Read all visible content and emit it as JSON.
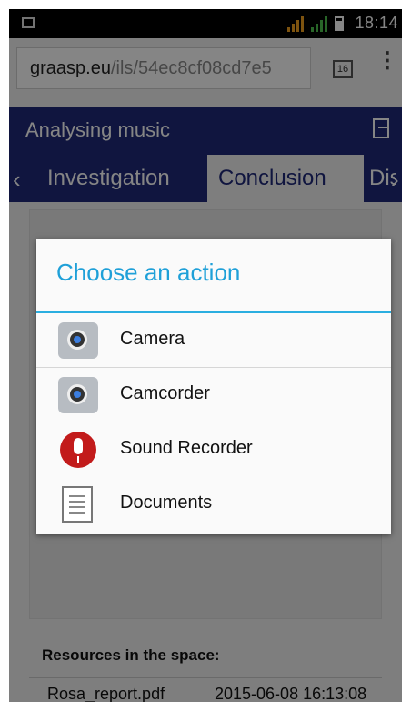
{
  "status_bar": {
    "time": "18:14"
  },
  "browser": {
    "url_domain": "graasp.eu",
    "url_path": "/ils/54ec8cf08cd7e5",
    "tab_count": "16",
    "menu_glyph": "⋮"
  },
  "app": {
    "title": "Analysing music",
    "tabs": [
      {
        "label": "Investigation"
      },
      {
        "label": "Conclusion"
      },
      {
        "label": "Dis"
      }
    ],
    "prev_glyph": "‹",
    "next_glyph": "›"
  },
  "dialog": {
    "title": "Choose an action",
    "items": [
      {
        "label": "Camera",
        "icon": "camera-icon"
      },
      {
        "label": "Camcorder",
        "icon": "camcorder-icon"
      },
      {
        "label": "Sound Recorder",
        "icon": "microphone-icon"
      },
      {
        "label": "Documents",
        "icon": "document-icon"
      }
    ]
  },
  "resources": {
    "heading": "Resources in the space:",
    "files": [
      {
        "name": "Rosa_report.pdf",
        "date": "2015-06-08 16:13:08"
      }
    ]
  },
  "colors": {
    "app_bar": "#1f2a7a",
    "dialog_accent": "#1fa0d8"
  }
}
